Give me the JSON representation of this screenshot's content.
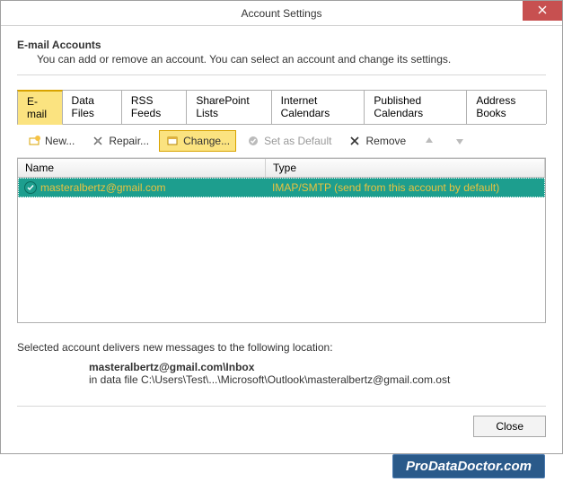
{
  "window": {
    "title": "Account Settings"
  },
  "header": {
    "title": "E-mail Accounts",
    "description": "You can add or remove an account. You can select an account and change its settings."
  },
  "tabs": [
    {
      "label": "E-mail",
      "active": true
    },
    {
      "label": "Data Files"
    },
    {
      "label": "RSS Feeds"
    },
    {
      "label": "SharePoint Lists"
    },
    {
      "label": "Internet Calendars"
    },
    {
      "label": "Published Calendars"
    },
    {
      "label": "Address Books"
    }
  ],
  "toolbar": {
    "new": "New...",
    "repair": "Repair...",
    "change": "Change...",
    "set_default": "Set as Default",
    "remove": "Remove"
  },
  "table": {
    "columns": {
      "name": "Name",
      "type": "Type"
    },
    "rows": [
      {
        "name": "masteralbertz@gmail.com",
        "type": "IMAP/SMTP (send from this account by default)"
      }
    ]
  },
  "delivery": {
    "intro": "Selected account delivers new messages to the following location:",
    "location_bold": "masteralbertz@gmail.com\\Inbox",
    "location_path": "in data file C:\\Users\\Test\\...\\Microsoft\\Outlook\\masteralbertz@gmail.com.ost"
  },
  "buttons": {
    "close": "Close"
  },
  "watermark": "ProDataDoctor.com"
}
